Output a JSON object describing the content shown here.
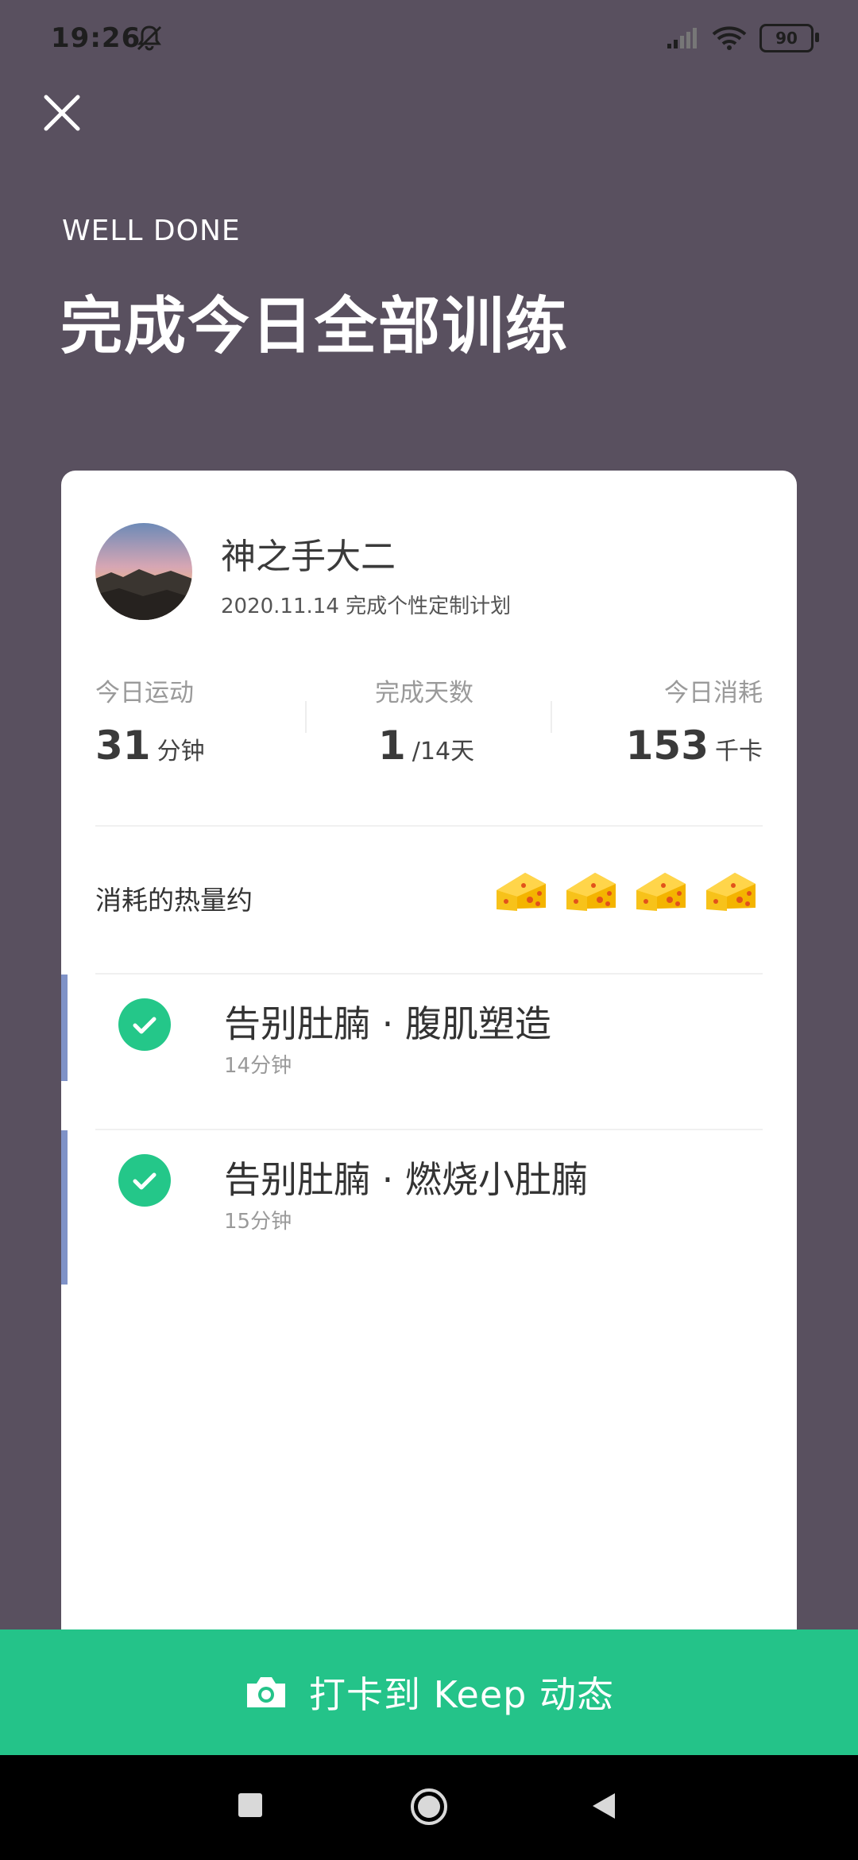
{
  "status": {
    "time": "19:26",
    "battery": "90"
  },
  "hero": {
    "subtitle": "WELL DONE",
    "title": "完成今日全部训练"
  },
  "user": {
    "name": "神之手大二",
    "subtitle": "2020.11.14 完成个性定制计划"
  },
  "stats": [
    {
      "label": "今日运动",
      "value": "31",
      "unit": "分钟"
    },
    {
      "label": "完成天数",
      "value": "1",
      "unit": "/14天"
    },
    {
      "label": "今日消耗",
      "value": "153",
      "unit": "千卡"
    }
  ],
  "calories": {
    "label": "消耗的热量约",
    "icon": "cheese-icon",
    "count": 4
  },
  "workouts": [
    {
      "title": "告别肚腩 · 腹肌塑造",
      "duration": "14分钟"
    },
    {
      "title": "告别肚腩 · 燃烧小肚腩",
      "duration": "15分钟"
    }
  ],
  "cta": {
    "label": "打卡到 Keep 动态",
    "icon": "camera-icon"
  },
  "colors": {
    "background": "#59505f",
    "accent": "#24c389",
    "check": "#24c789",
    "bar": "#7f92c7"
  }
}
